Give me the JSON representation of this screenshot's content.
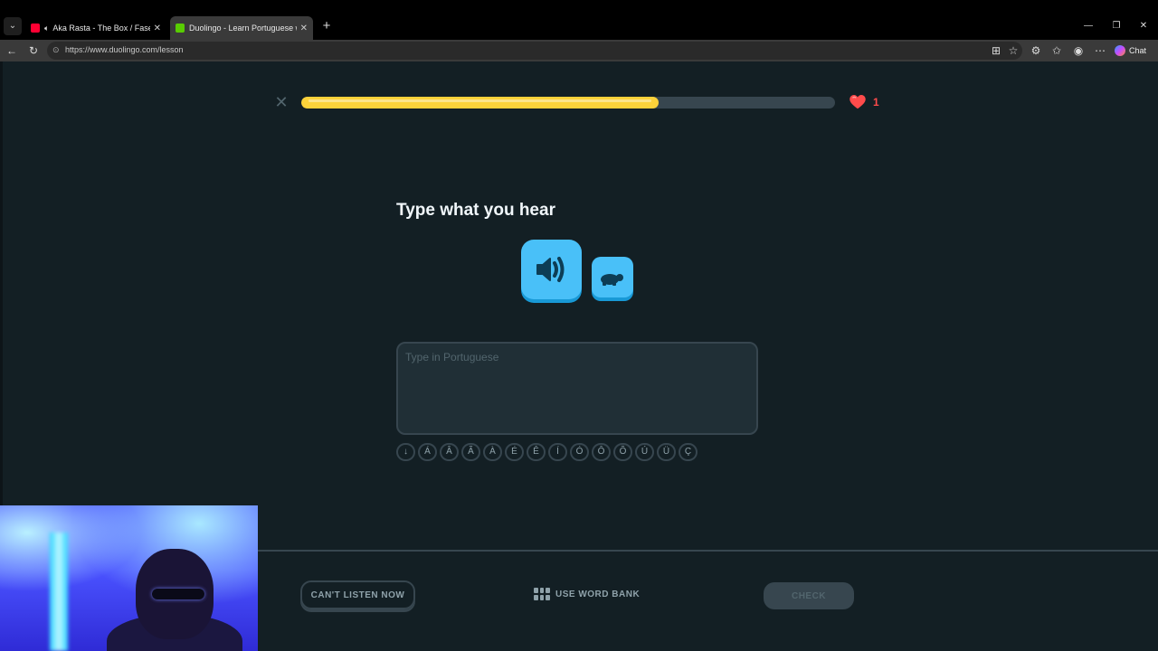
{
  "browser": {
    "tabs": [
      {
        "title": "Aka Rasta - The Box / Fases R",
        "favicon": "youtube-icon",
        "audio": true,
        "active": false
      },
      {
        "title": "Duolingo - Learn Portuguese with",
        "favicon": "duolingo-icon",
        "audio": false,
        "active": true
      }
    ],
    "url": "https://www.duolingo.com/lesson",
    "chat_label": "Chat"
  },
  "lesson": {
    "progress_fraction": 0.67,
    "hearts": "1",
    "prompt_title": "Type what you hear",
    "answer_placeholder": "Type in Portuguese",
    "accent_keys": [
      "↓",
      "Á",
      "Â",
      "Ã",
      "À",
      "É",
      "Ê",
      "Í",
      "Ó",
      "Ô",
      "Õ",
      "Ú",
      "Ü",
      "Ç"
    ]
  },
  "footer": {
    "cant_listen_label": "CAN'T LISTEN NOW",
    "word_bank_label": "USE WORD BANK",
    "check_label": "CHECK"
  },
  "colors": {
    "background": "#131f24",
    "progress_fill": "#fcd23a",
    "progress_track": "#37464f",
    "audio_button": "#49c0f8",
    "heart": "#ff4b4b"
  }
}
